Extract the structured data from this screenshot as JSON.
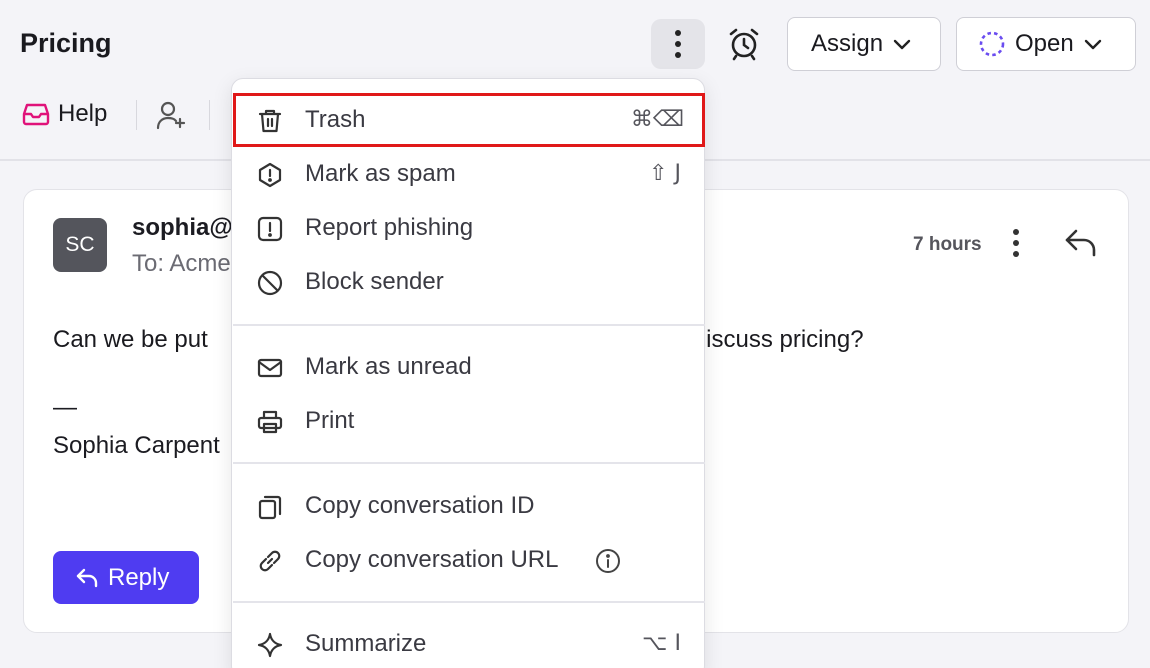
{
  "header": {
    "title": "Pricing",
    "assign_label": "Assign",
    "status_label": "Open"
  },
  "subheader": {
    "inbox_label": "Help"
  },
  "message": {
    "avatar_initials": "SC",
    "sender": "sophia@",
    "recipient": "To: Acme",
    "time": "7 hours",
    "body_start": "Can we be put",
    "body_end": "o discuss pricing?",
    "signature_dash": "—",
    "signature_name": "Sophia Carpent",
    "reply_label": "Reply"
  },
  "menu": {
    "items": [
      {
        "label": "Trash",
        "shortcut": "⌘⌫",
        "icon": "trash-icon"
      },
      {
        "label": "Mark as spam",
        "shortcut": "⇧ J",
        "icon": "spam-icon"
      },
      {
        "label": "Report phishing",
        "shortcut": "",
        "icon": "alert-icon"
      },
      {
        "label": "Block sender",
        "shortcut": "",
        "icon": "block-icon"
      },
      {
        "label": "Mark as unread",
        "shortcut": "",
        "icon": "envelope-icon"
      },
      {
        "label": "Print",
        "shortcut": "",
        "icon": "printer-icon"
      },
      {
        "label": "Copy conversation ID",
        "shortcut": "",
        "icon": "copy-icon"
      },
      {
        "label": "Copy conversation URL",
        "shortcut": "",
        "icon": "link-icon"
      },
      {
        "label": "Summarize",
        "shortcut": "⌥ I",
        "icon": "sparkle-icon"
      }
    ]
  },
  "colors": {
    "accent": "#4f3cf1",
    "highlight_border": "#e01818",
    "inbox_icon": "#e0127a",
    "status_dashed": "#6a4cf0"
  }
}
